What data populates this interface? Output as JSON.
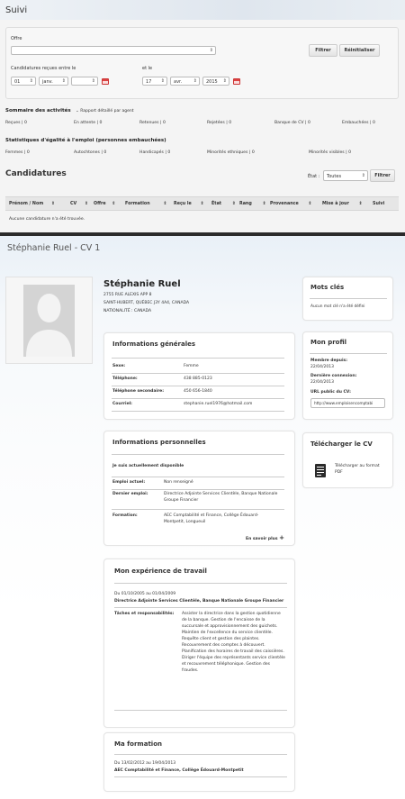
{
  "suivi": {
    "title": "Suivi",
    "offre_label": "Offre",
    "filter_button": "Filtrer",
    "reset_button": "Réinitialiser",
    "received_between_label": "Candidatures reçues entre le",
    "and_label": "et le",
    "date_from": {
      "day": "01",
      "month": "janv.",
      "year": ""
    },
    "date_to": {
      "day": "17",
      "month": "avr.",
      "year": "2015"
    },
    "activity_summary_title": "Sommaire des activités",
    "detailed_report_link": "Rapport détaillé par agent",
    "activity_stats": [
      {
        "label": "Reçues",
        "value": "0"
      },
      {
        "label": "En attente",
        "value": "0"
      },
      {
        "label": "Retenues",
        "value": "0"
      },
      {
        "label": "Rejetées",
        "value": "0"
      },
      {
        "label": "Banque de CV",
        "value": "0"
      },
      {
        "label": "Embauchées",
        "value": "0"
      }
    ],
    "equality_title": "Statistiques d'égalité à l'emploi (personnes embauchées)",
    "equality_stats": [
      {
        "label": "Femmes",
        "value": "0"
      },
      {
        "label": "Autochtones",
        "value": "0"
      },
      {
        "label": "Handicapés",
        "value": "0"
      },
      {
        "label": "Minorités ethniques",
        "value": "0"
      },
      {
        "label": "Minorités visibles",
        "value": "0"
      }
    ]
  },
  "candidatures": {
    "title": "Candidatures",
    "state_label": "État :",
    "state_value": "Toutes",
    "filter_button": "Filtrer",
    "columns": [
      "Prénom / Nom",
      "CV",
      "Offre",
      "Formation",
      "Reçu le",
      "État",
      "Rang",
      "Provenance",
      "Mise à jour",
      "Suivi"
    ],
    "empty_message": "Aucune candidature n'a été trouvée."
  },
  "profile": {
    "page_title": "Stéphanie Ruel - CV 1",
    "name": "Stéphanie Ruel",
    "address_line1": "2755 RUE ALEXIS APP 8",
    "address_line2": "SAINT-HUBERT, QUÉBEC J3Y 4A4, CANADA",
    "nationality": "NATIONALITÉ : CANADA",
    "general": {
      "title": "Informations générales",
      "rows": [
        {
          "key": "Sexe:",
          "value": "Femme"
        },
        {
          "key": "Téléphone:",
          "value": "438 885-0123"
        },
        {
          "key": "Téléphone secondaire:",
          "value": "450 656-1840"
        },
        {
          "key": "Courriel:",
          "value": "stephanie.ruel1976@hotmail.com"
        }
      ]
    },
    "personal": {
      "title": "Informations personnelles",
      "availability": "Je suis actuellement disponible",
      "rows": [
        {
          "key": "Emploi actuel:",
          "value": "Non renseigné"
        },
        {
          "key": "Dernier emploi:",
          "value": "Directrice Adjointe Services Clientèle, Banque Nationale Groupe Financier"
        },
        {
          "key": "Formation:",
          "value": "AEC Comptabilité et Finance, Collège Édouard-Montpetit, Longueuil"
        }
      ],
      "more_link": "En savoir plus"
    },
    "experience": {
      "title": "Mon expérience de travail",
      "period": "Du 01/10/2005 au 01/04/2009",
      "position": "Directrice Adjointe Services Clientèle, Banque Nationale Groupe Financier",
      "tasks_label": "Tâches et responsabilités:",
      "tasks": "Assister la directrice dans la gestion quotidienne de la banque. Gestion de l'encaisse de la succursale et approvisionnement des guichets. Maintien de l'excellence du service clientèle. Requête client et gestion des plaintes. Recouvrement des comptes à découvert. Planification des horaires de travail des caissières. Diriger l'équipe des représentants service clientèle et recouvrement téléphonique. Gestion des fraudes."
    },
    "education": {
      "title": "Ma formation",
      "period": "Du 13/02/2012 au 19/04/2013",
      "program": "AEC Comptabilité et Finance, Collège Édouard-Montpetit"
    },
    "keywords": {
      "title": "Mots clés",
      "text": "Aucun mot clé n'a été défini"
    },
    "my_profile": {
      "title": "Mon profil",
      "member_since_label": "Membre depuis:",
      "member_since": "22/04/2013",
      "last_login_label": "Dernière connexion:",
      "last_login": "22/04/2013",
      "public_url_label": "URL public du CV:",
      "public_url": "http://www.emploisencomptabi"
    },
    "download": {
      "title": "Télécharger le CV",
      "link": "Télécharger au format PDF"
    }
  }
}
